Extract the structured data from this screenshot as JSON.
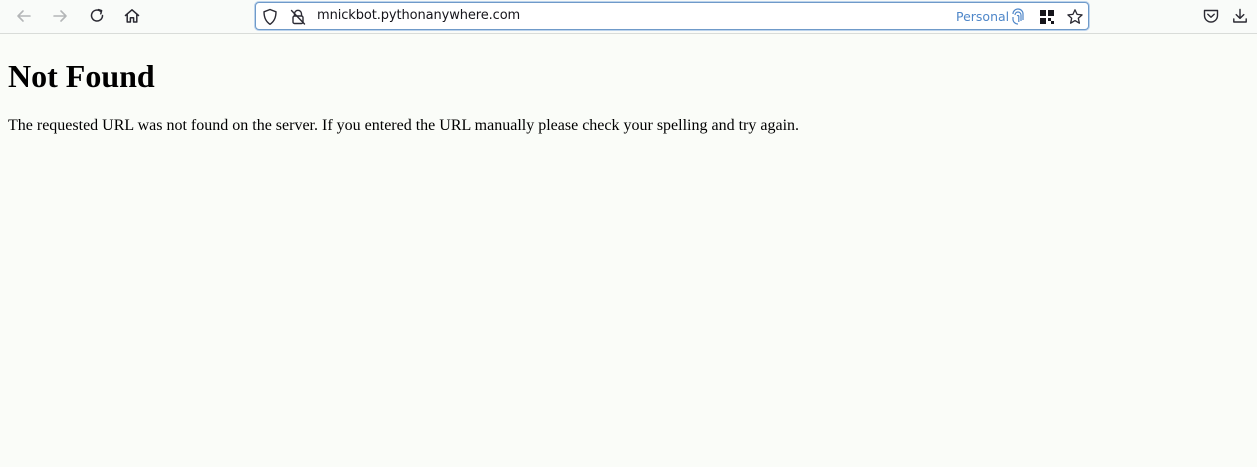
{
  "browser": {
    "url": "mnickbot.pythonanywhere.com",
    "container_label": "Personal",
    "icons": {
      "back": "back-arrow-icon",
      "forward": "forward-arrow-icon",
      "reload": "reload-icon",
      "home": "home-icon",
      "tracking_protection": "shield-icon",
      "connection": "insecure-lock-icon",
      "container": "fingerprint-icon",
      "extension": "grid-apps-icon",
      "bookmark": "star-icon",
      "pocket": "pocket-icon",
      "downloads": "download-icon"
    },
    "colors": {
      "accent": "#4f87c9",
      "url_border": "#6f9ac9",
      "page_background": "#fafcf8"
    }
  },
  "page": {
    "heading": "Not Found",
    "message": "The requested URL was not found on the server. If you entered the URL manually please check your spelling and try again."
  }
}
